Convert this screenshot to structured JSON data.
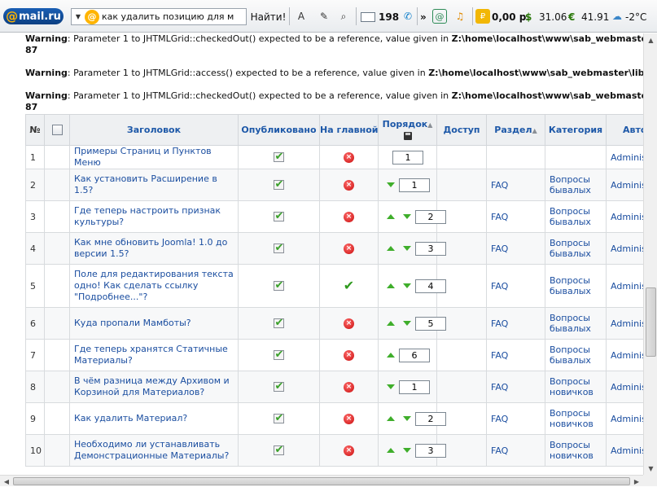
{
  "toolbar": {
    "logo_text": "mail.ru",
    "search_value": "как удалить позицию для м",
    "find_label": "Найти!",
    "mail_count": "198",
    "more_label": "»",
    "balance": "0,00 р.",
    "usd": "31.06",
    "eur": "41.91",
    "weather": "-2°C"
  },
  "warnings": [
    {
      "prefix": "Warning",
      "text": ": Parameter 1 to JHTMLGrid::checkedOut() expected to be a reference, value given in ",
      "path": "Z:\\home\\localhost\\www\\sab_webmaster\\libraries\\joom",
      "line": "87"
    },
    {
      "prefix": "Warning",
      "text": ": Parameter 1 to JHTMLGrid::access() expected to be a reference, value given in ",
      "path": "Z:\\home\\localhost\\www\\sab_webmaster\\libraries\\joomla\\h"
    },
    {
      "prefix": "Warning",
      "text": ": Parameter 1 to JHTMLGrid::checkedOut() expected to be a reference, value given in ",
      "path": "Z:\\home\\localhost\\www\\sab_webmaster\\libraries\\joom",
      "line": "87"
    }
  ],
  "table": {
    "headers": {
      "num": "№",
      "title": "Заголовок",
      "published": "Опубликовано",
      "frontpage": "На главной",
      "order": "Порядок",
      "access": "Доступ",
      "section": "Раздел",
      "category": "Категория",
      "author": "Автор"
    },
    "rows": [
      {
        "num": "1",
        "title": "Примеры Страниц и Пунктов Меню",
        "front": "no",
        "up": false,
        "down": false,
        "order": "1",
        "section": "",
        "cat1": "",
        "cat2": "",
        "author": "Administr"
      },
      {
        "num": "2",
        "title": "Как установить Расширение в 1.5?",
        "front": "no",
        "up": false,
        "down": true,
        "order": "1",
        "section": "FAQ",
        "cat1": "Вопросы",
        "cat2": "бывалых",
        "author": "Administr"
      },
      {
        "num": "3",
        "title": "Где теперь настроить признак культуры?",
        "front": "no",
        "up": true,
        "down": true,
        "order": "2",
        "section": "FAQ",
        "cat1": "Вопросы",
        "cat2": "бывалых",
        "author": "Administr"
      },
      {
        "num": "4",
        "title": "Как мне обновить Joomla! 1.0 до версии 1.5?",
        "front": "no",
        "up": true,
        "down": true,
        "order": "3",
        "section": "FAQ",
        "cat1": "Вопросы",
        "cat2": "бывалых",
        "author": "Administr"
      },
      {
        "num": "5",
        "title": "Поле для редактирования текста одно! Как сделать ссылку \"Подробнее...\"?",
        "front": "yes",
        "up": true,
        "down": true,
        "order": "4",
        "section": "FAQ",
        "cat1": "Вопросы",
        "cat2": "бывалых",
        "author": "Administr"
      },
      {
        "num": "6",
        "title": "Куда пропали Мамботы?",
        "front": "no",
        "up": true,
        "down": true,
        "order": "5",
        "section": "FAQ",
        "cat1": "Вопросы",
        "cat2": "бывалых",
        "author": "Administr"
      },
      {
        "num": "7",
        "title": "Где теперь хранятся Статичные Материалы?",
        "front": "no",
        "up": true,
        "down": false,
        "order": "6",
        "section": "FAQ",
        "cat1": "Вопросы",
        "cat2": "бывалых",
        "author": "Administr"
      },
      {
        "num": "8",
        "title": "В чём разница между Архивом и Корзиной для Материалов?",
        "front": "no",
        "up": false,
        "down": true,
        "order": "1",
        "section": "FAQ",
        "cat1": "Вопросы",
        "cat2": "новичков",
        "author": "Administr"
      },
      {
        "num": "9",
        "title": "Как удалить Материал?",
        "front": "no",
        "up": true,
        "down": true,
        "order": "2",
        "section": "FAQ",
        "cat1": "Вопросы",
        "cat2": "новичков",
        "author": "Administr"
      },
      {
        "num": "10",
        "title": "Необходимо ли устанавливать Демонстрационные Материалы?",
        "front": "no",
        "up": true,
        "down": true,
        "order": "3",
        "section": "FAQ",
        "cat1": "Вопросы",
        "cat2": "новичков",
        "author": "Administr"
      }
    ]
  }
}
